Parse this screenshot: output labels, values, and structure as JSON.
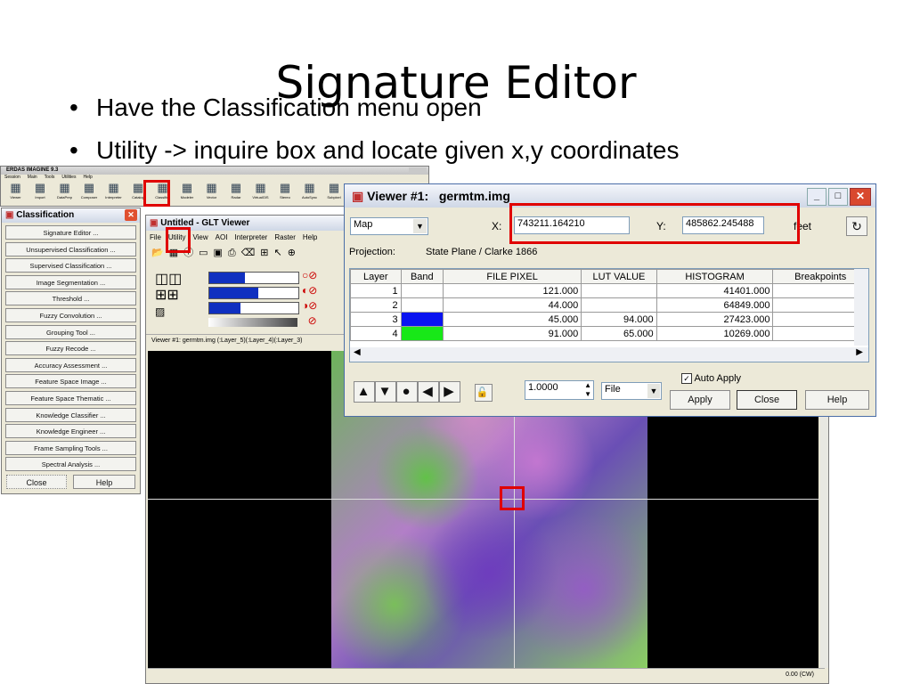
{
  "slide": {
    "title": "Signature Editor",
    "bullets": [
      "Have the Classification menu open",
      "Utility -> inquire box and locate given x,y coordinates"
    ]
  },
  "erdas": {
    "title": "ERDAS IMAGINE 9.3",
    "menu": [
      "Session",
      "Main",
      "Tools",
      "Utilities",
      "Help"
    ],
    "tools": [
      "Viewer",
      "Import",
      "DataPrep",
      "Composer",
      "Interpreter",
      "Catalog",
      "Classifier",
      "Modeler",
      "Vector",
      "Radar",
      "VirtualGIS",
      "Stereo",
      "AutoSync",
      "Subpixel"
    ]
  },
  "classification": {
    "title": "Classification",
    "items": [
      "Signature Editor ...",
      "Unsupervised Classification ...",
      "Supervised Classification ...",
      "Image Segmentation ...",
      "Threshold ...",
      "Fuzzy Convolution ...",
      "Grouping Tool ...",
      "Fuzzy Recode ...",
      "Accuracy Assessment ...",
      "Feature Space Image ...",
      "Feature Space Thematic ...",
      "Knowledge Classifier ...",
      "Knowledge Engineer ...",
      "Frame Sampling Tools ...",
      "Spectral Analysis ..."
    ],
    "close": "Close",
    "help": "Help"
  },
  "glt": {
    "title": "Untitled - GLT Viewer",
    "menu": [
      "File",
      "Utility",
      "View",
      "AOI",
      "Interpreter",
      "Raster",
      "Help"
    ],
    "status": "Viewer #1: germtm.img (:Layer_5)(:Layer_4)(:Layer_3)",
    "rotation": "0.00 (CW)"
  },
  "inquire": {
    "title": "Viewer #1:",
    "file": "germtm.img",
    "coord_type": "Map",
    "x_label": "X:",
    "x_value": "743211.164210",
    "y_label": "Y:",
    "y_value": "485862.245488",
    "units": "feet",
    "projection_label": "Projection:",
    "projection_value": "State Plane / Clarke 1866",
    "columns": [
      "Layer",
      "Band",
      "FILE PIXEL",
      "LUT VALUE",
      "HISTOGRAM",
      "Breakpoints"
    ],
    "rows": [
      {
        "layer": "1",
        "band_color": "",
        "file_pixel": "121.000",
        "lut": "",
        "hist": "41401.000"
      },
      {
        "layer": "2",
        "band_color": "",
        "file_pixel": "44.000",
        "lut": "",
        "hist": "64849.000"
      },
      {
        "layer": "3",
        "band_color": "#0a14f0",
        "file_pixel": "45.000",
        "lut": "94.000",
        "hist": "27423.000"
      },
      {
        "layer": "4",
        "band_color": "#18e818",
        "file_pixel": "91.000",
        "lut": "65.000",
        "hist": "10269.000"
      }
    ],
    "step_value": "1.0000",
    "step_unit": "File",
    "auto_apply": "Auto Apply",
    "apply": "Apply",
    "close": "Close",
    "help": "Help"
  },
  "colors": {
    "highlight": "#e00000",
    "band_blue": "#0a14f0",
    "band_green": "#18e818"
  }
}
